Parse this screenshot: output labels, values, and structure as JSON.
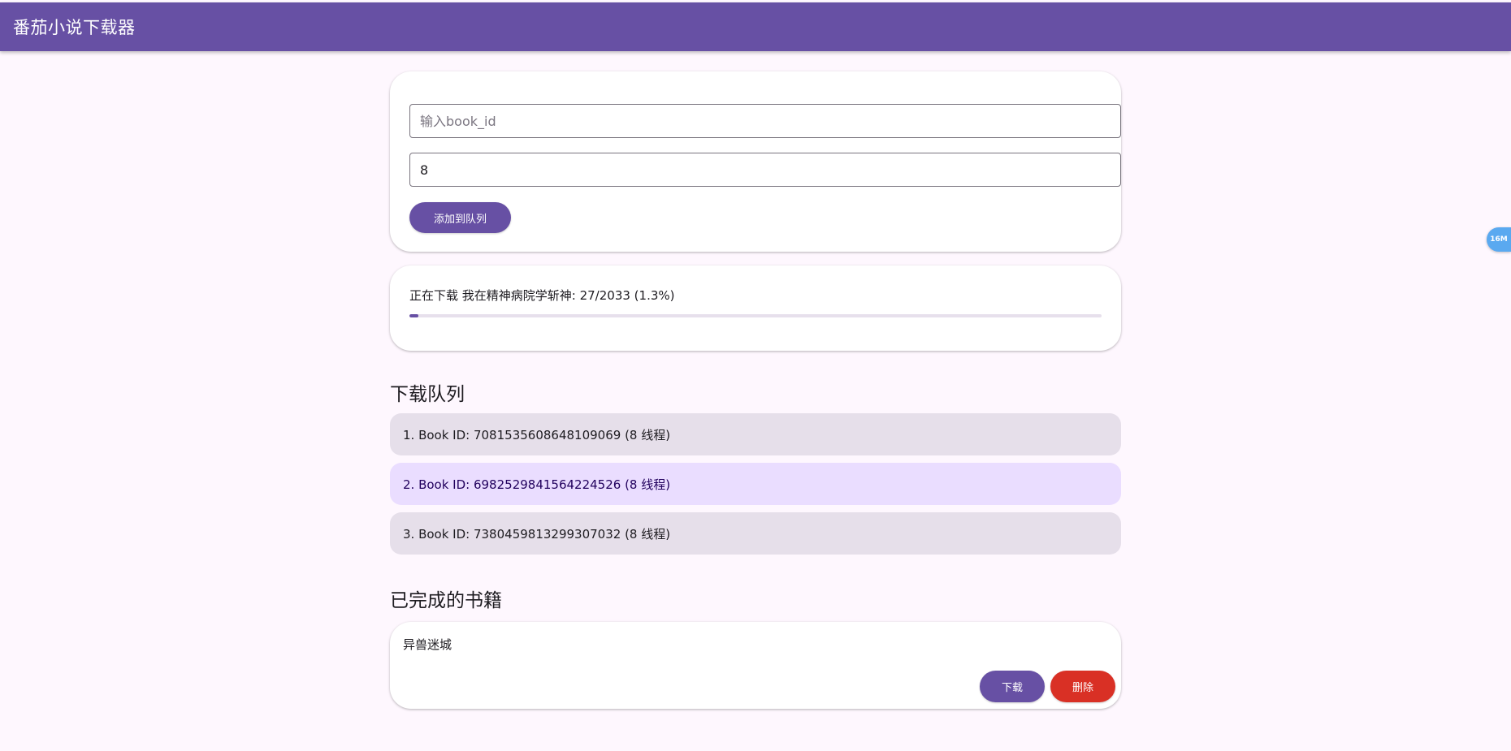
{
  "app": {
    "title": "番茄小说下载器"
  },
  "form": {
    "book_id_placeholder": "输入book_id",
    "book_id_value": "",
    "threads_value": "8",
    "add_button_label": "添加到队列"
  },
  "progress": {
    "text": "正在下载 我在精神病院学斩神: 27/2033 (1.3%)",
    "book_title": "我在精神病院学斩神",
    "current": 27,
    "total": 2033,
    "percent": 1.3
  },
  "queue": {
    "title": "下载队列",
    "items": [
      {
        "label": "1. Book ID: 7081535608648109069 (8 线程)"
      },
      {
        "label": "2. Book ID: 6982529841564224526 (8 线程)"
      },
      {
        "label": "3. Book ID: 7380459813299307032 (8 线程)"
      }
    ]
  },
  "completed": {
    "title": "已完成的书籍",
    "books": [
      {
        "name": "异兽迷城",
        "download_label": "下载",
        "delete_label": "删除"
      }
    ]
  },
  "floating_badge": {
    "label": "16M"
  },
  "colors": {
    "primary": "#6750a4",
    "danger": "#d93025",
    "background": "#fef7fe",
    "queue_item": "#e6dfea",
    "queue_item_highlight": "#eaddff",
    "badge": "#5aa9f0"
  }
}
